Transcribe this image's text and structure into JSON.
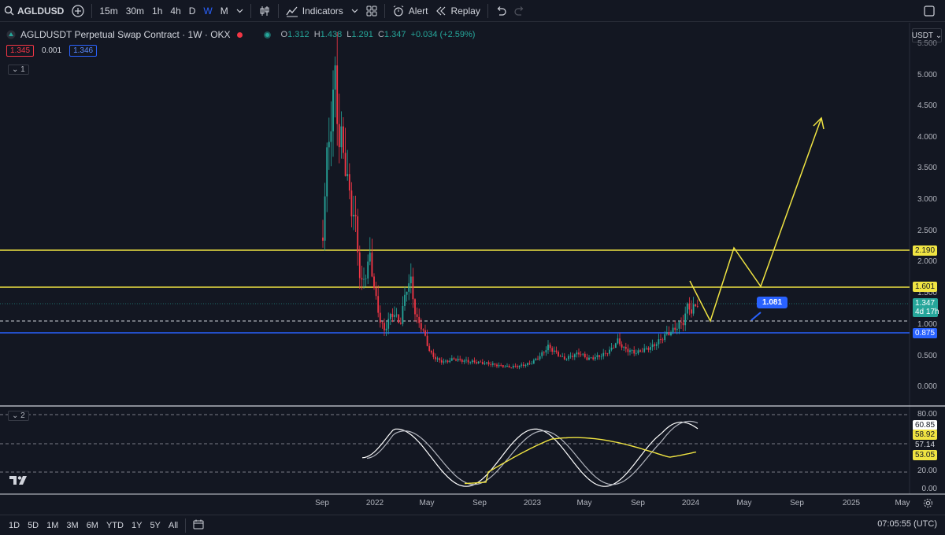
{
  "toolbar": {
    "symbol": "AGLDUSD",
    "timeframes": [
      "15m",
      "30m",
      "1h",
      "4h",
      "D",
      "W",
      "M"
    ],
    "active_timeframe": "W",
    "indicators_label": "Indicators",
    "alert_label": "Alert",
    "replay_label": "Replay"
  },
  "legend": {
    "title": "AGLDUSDT Perpetual Swap Contract · 1W · OKX",
    "o_label": "O",
    "o_value": "1.312",
    "h_label": "H",
    "h_value": "1.438",
    "l_label": "L",
    "l_value": "1.291",
    "c_label": "C",
    "c_value": "1.347",
    "change": "+0.034 (+2.59%)",
    "bid": "1.345",
    "spread": "0.001",
    "ask": "1.346",
    "pane1_tag": "1",
    "pane2_tag": "2"
  },
  "price_axis": {
    "currency": "USDT",
    "ticks": [
      "5.000",
      "4.500",
      "4.000",
      "3.500",
      "3.000",
      "2.500",
      "2.000",
      "1.500",
      "1.000",
      "0.500",
      "0.000"
    ],
    "top_partial": "5.500",
    "tags": {
      "upper_line": "2.190",
      "lower_line": "1.601",
      "last_price": "1.347",
      "countdown": "4d 17h",
      "support_line": "0.875"
    }
  },
  "annotation": {
    "fib_label": "1.081"
  },
  "osc_axis": {
    "ticks": [
      "80.00",
      "20.00",
      "0.00"
    ],
    "tags": [
      "60.85",
      "58.92",
      "57.14",
      "53.05"
    ]
  },
  "time_axis": [
    "Sep",
    "2022",
    "May",
    "Sep",
    "2023",
    "May",
    "Sep",
    "2024",
    "May",
    "Sep",
    "2025",
    "May"
  ],
  "bottombar": {
    "ranges": [
      "1D",
      "5D",
      "1M",
      "3M",
      "6M",
      "YTD",
      "1Y",
      "5Y",
      "All"
    ],
    "clock": "07:05:55 (UTC)"
  },
  "colors": {
    "background": "#131722",
    "up": "#26a69a",
    "down": "#f23645",
    "level_line": "#f0e442",
    "support_line": "#2962ff",
    "accent": "#2962ff"
  }
}
